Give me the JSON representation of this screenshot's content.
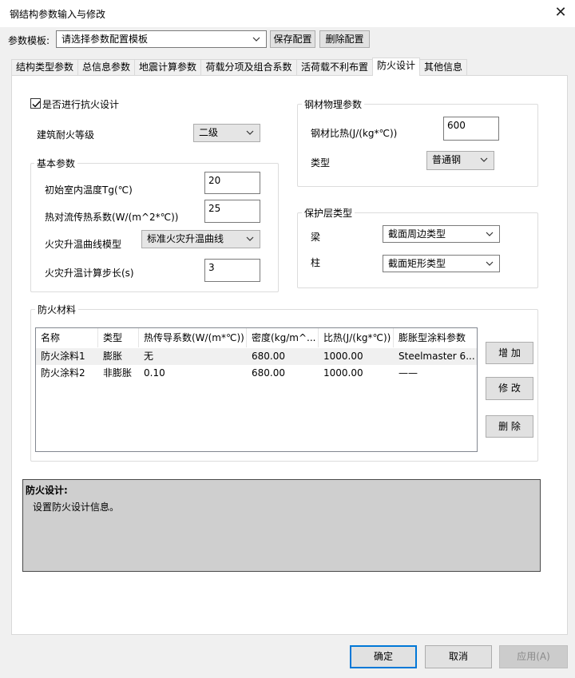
{
  "window": {
    "title": "钢结构参数输入与修改",
    "close_glyph": "✕"
  },
  "template_bar": {
    "label": "参数模板:",
    "select_value": "请选择参数配置模板",
    "save_label": "保存配置",
    "delete_label": "删除配置"
  },
  "tabs": [
    {
      "label": "结构类型参数",
      "active": false
    },
    {
      "label": "总信息参数",
      "active": false
    },
    {
      "label": "地震计算参数",
      "active": false
    },
    {
      "label": "荷载分项及组合系数",
      "active": false
    },
    {
      "label": "活荷载不利布置",
      "active": false
    },
    {
      "label": "防火设计",
      "active": true
    },
    {
      "label": "其他信息",
      "active": false
    }
  ],
  "fire": {
    "enable_label": "是否进行抗火设计",
    "enable_checked": true,
    "resistance_label": "建筑耐火等级",
    "resistance_value": "二级",
    "basic_group": "基本参数",
    "init_temp_label": "初始室内温度Tg(℃)",
    "init_temp_value": "20",
    "convection_label": "热对流传热系数(W/(m^2*℃))",
    "convection_value": "25",
    "curve_label": "火灾升温曲线模型",
    "curve_value": "标准火灾升温曲线",
    "step_label": "火灾升温计算步长(s)",
    "step_value": "3"
  },
  "steel": {
    "group": "钢材物理参数",
    "heat_label": "钢材比热(J/(kg*℃))",
    "heat_value": "600",
    "type_label": "类型",
    "type_value": "普通钢"
  },
  "protect": {
    "group": "保护层类型",
    "beam_label": "梁",
    "beam_value": "截面周边类型",
    "column_label": "柱",
    "column_value": "截面矩形类型"
  },
  "materials": {
    "group": "防火材料",
    "columns": [
      "名称",
      "类型",
      "热传导系数(W/(m*℃))",
      "密度(kg/m^...",
      "比热(J/(kg*℃))",
      "膨胀型涂料参数"
    ],
    "rows": [
      [
        "防火涂料1",
        "膨胀",
        "无",
        "680.00",
        "1000.00",
        "Steelmaster 6..."
      ],
      [
        "防火涂料2",
        "非膨胀",
        "0.10",
        "680.00",
        "1000.00",
        "——"
      ]
    ],
    "add_label": "增 加",
    "edit_label": "修 改",
    "delete_label": "删 除"
  },
  "description": {
    "title": "防火设计:",
    "text": "设置防火设计信息。"
  },
  "footer": {
    "ok": "确定",
    "cancel": "取消",
    "apply": "应用(A)"
  }
}
